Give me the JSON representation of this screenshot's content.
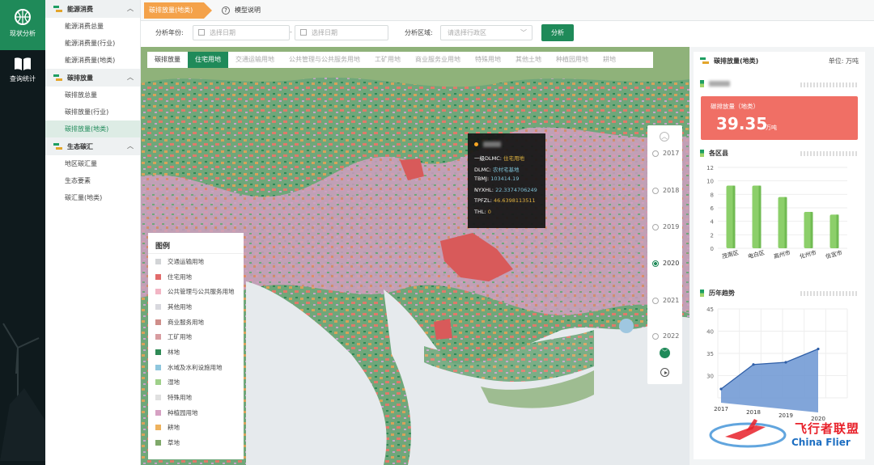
{
  "rail": {
    "items": [
      {
        "label": "现状分析",
        "icon": "basketball-icon",
        "active": true
      },
      {
        "label": "查询统计",
        "icon": "book-icon",
        "active": false
      }
    ]
  },
  "menu": {
    "groups": [
      {
        "title": "能源消费",
        "items": [
          "能源消费总量",
          "能源消费量(行业)",
          "能源消费量(地类)"
        ]
      },
      {
        "title": "碳排放量",
        "items": [
          "碳排放总量",
          "碳排放量(行业)",
          "碳排放量(地类)"
        ],
        "active_item": "碳排放量(地类)"
      },
      {
        "title": "生态碳汇",
        "items": [
          "地区碳汇量",
          "生态要素",
          "碳汇量(地类)"
        ]
      }
    ]
  },
  "topbar": {
    "active_tab": "碳排放量(地类)",
    "model_tab": "模型说明",
    "model_icon_glyph": "?"
  },
  "filter": {
    "year_label": "分析年份:",
    "start_placeholder": "选择日期",
    "separator": "-",
    "end_placeholder": "选择日期",
    "region_label": "分析区域:",
    "region_placeholder": "请选择行政区",
    "analyze_button": "分析"
  },
  "category_tabs": {
    "items": [
      "碳排放量",
      "住宅用地",
      "交通运输用地",
      "公共管理与公共服务用地",
      "工矿用地",
      "商业服务业用地",
      "特殊用地",
      "其他土地",
      "种植园用地",
      "耕地"
    ],
    "selected": "住宅用地"
  },
  "tooltip": {
    "rows": [
      {
        "key": "一级DLMC:",
        "value": "住宅用地",
        "style": "gold"
      },
      {
        "key": "DLMC:",
        "value": "农村宅基地",
        "style": "blue"
      },
      {
        "key": "TBMJ:",
        "value": "103414.19",
        "style": "blue"
      },
      {
        "key": "NYXHL:",
        "value": "22.3374706249",
        "style": "blue"
      },
      {
        "key": "TPFZL:",
        "value": "46.6398113511",
        "style": "gold"
      },
      {
        "key": "THL:",
        "value": "0",
        "style": "gold"
      }
    ]
  },
  "legend": {
    "title": "图例",
    "items": [
      {
        "label": "交通运输用地",
        "color": "#d2d4d6"
      },
      {
        "label": "住宅用地",
        "color": "#e26b6b"
      },
      {
        "label": "公共管理与公共服务用地",
        "color": "#f2b5c4"
      },
      {
        "label": "其他用地",
        "color": "#d8d8de"
      },
      {
        "label": "商业服务用地",
        "color": "#cf8e8a"
      },
      {
        "label": "工矿用地",
        "color": "#d89ca0"
      },
      {
        "label": "林地",
        "color": "#2f8a56"
      },
      {
        "label": "水域及水利设施用地",
        "color": "#8fc7de"
      },
      {
        "label": "湿地",
        "color": "#9fd08a"
      },
      {
        "label": "特殊用地",
        "color": "#e0e0e0"
      },
      {
        "label": "种植园用地",
        "color": "#d6a1c3"
      },
      {
        "label": "耕地",
        "color": "#eeb25e"
      },
      {
        "label": "草地",
        "color": "#7fa86a"
      }
    ]
  },
  "timeline": {
    "years": [
      "2017",
      "2018",
      "2019",
      "2020",
      "2021",
      "2022"
    ],
    "selected": "2020",
    "up_glyph": "︿",
    "down_glyph": "﹀"
  },
  "panel": {
    "title": "碳排放量(地类)",
    "unit": "单位: 万吨",
    "card": {
      "label": "碳排放量（地类）",
      "value": "39.35",
      "unit": "万吨"
    },
    "district_title": "各区县",
    "trend_title": "历年趋势"
  },
  "chart_data": [
    {
      "type": "bar",
      "title": "各区县",
      "categories": [
        "茂南区",
        "电白区",
        "高州市",
        "化州市",
        "信宜市"
      ],
      "values": [
        9.3,
        9.3,
        7.6,
        5.4,
        5.0
      ],
      "ylim": [
        0,
        12
      ],
      "yticks": [
        "0",
        "2",
        "4",
        "6",
        "8",
        "10",
        "12"
      ],
      "color": "#8ccf6a"
    },
    {
      "type": "area",
      "title": "历年趋势",
      "categories": [
        "2017",
        "2018",
        "2019",
        "2020"
      ],
      "values": [
        27,
        32.5,
        33,
        36
      ],
      "ylim": [
        25,
        45
      ],
      "yticks": [
        "",
        "30",
        "35",
        "40",
        "45"
      ],
      "color": "#6b95d2"
    }
  ],
  "watermark": {
    "title": "飞行者联盟",
    "subtitle": "China Flier"
  }
}
